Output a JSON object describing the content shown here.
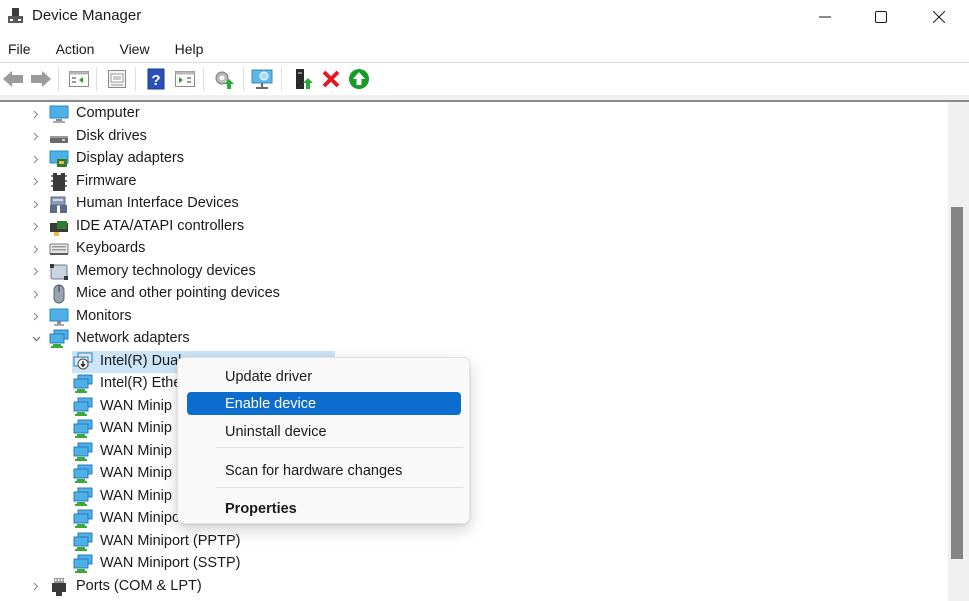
{
  "window": {
    "title": "Device Manager",
    "controls": [
      "minimize",
      "maximize",
      "close"
    ]
  },
  "menubar": {
    "items": [
      "File",
      "Action",
      "View",
      "Help"
    ]
  },
  "toolbar": {
    "buttons": [
      {
        "name": "back",
        "icon": "arrow-left-icon"
      },
      {
        "name": "forward",
        "icon": "arrow-right-icon"
      },
      {
        "name": "show-hide-console-tree",
        "icon": "console-tree-icon"
      },
      {
        "name": "properties",
        "icon": "properties-sheet-icon"
      },
      {
        "name": "help",
        "icon": "help-icon",
        "glyph": "?"
      },
      {
        "name": "show-hide-action-pane",
        "icon": "action-pane-icon"
      },
      {
        "name": "update-driver",
        "icon": "update-driver-icon"
      },
      {
        "name": "scan-hardware",
        "icon": "scan-monitor-icon"
      },
      {
        "name": "enable-legacy",
        "icon": "add-legacy-hardware-icon"
      },
      {
        "name": "uninstall-device",
        "icon": "red-x-icon"
      },
      {
        "name": "enable-device",
        "icon": "green-up-arrow-icon"
      }
    ]
  },
  "tree": {
    "items": [
      {
        "label": "Computer",
        "icon": "computer-icon",
        "expanded": false,
        "level": 1
      },
      {
        "label": "Disk drives",
        "icon": "disk-drive-icon",
        "expanded": false,
        "level": 1
      },
      {
        "label": "Display adapters",
        "icon": "display-adapter-icon",
        "expanded": false,
        "level": 1
      },
      {
        "label": "Firmware",
        "icon": "firmware-chip-icon",
        "expanded": false,
        "level": 1
      },
      {
        "label": "Human Interface Devices",
        "icon": "hid-icon",
        "expanded": false,
        "level": 1
      },
      {
        "label": "IDE ATA/ATAPI controllers",
        "icon": "ide-controller-icon",
        "expanded": false,
        "level": 1
      },
      {
        "label": "Keyboards",
        "icon": "keyboard-icon",
        "expanded": false,
        "level": 1
      },
      {
        "label": "Memory technology devices",
        "icon": "memory-device-icon",
        "expanded": false,
        "level": 1
      },
      {
        "label": "Mice and other pointing devices",
        "icon": "mouse-icon",
        "expanded": false,
        "level": 1
      },
      {
        "label": "Monitors",
        "icon": "monitor-icon",
        "expanded": false,
        "level": 1
      },
      {
        "label": "Network adapters",
        "icon": "network-adapter-icon",
        "expanded": true,
        "level": 1
      },
      {
        "label": "Intel(R) Dual",
        "icon": "network-adapter-disabled-icon",
        "level": 2,
        "selected": true
      },
      {
        "label": "Intel(R) Ethe",
        "icon": "network-adapter-icon",
        "level": 2
      },
      {
        "label": "WAN Minip",
        "icon": "network-adapter-icon",
        "level": 2
      },
      {
        "label": "WAN Minip",
        "icon": "network-adapter-icon",
        "level": 2
      },
      {
        "label": "WAN Minip",
        "icon": "network-adapter-icon",
        "level": 2
      },
      {
        "label": "WAN Minip",
        "icon": "network-adapter-icon",
        "level": 2
      },
      {
        "label": "WAN Minip",
        "icon": "network-adapter-icon",
        "level": 2
      },
      {
        "label": "WAN Minipo",
        "icon": "network-adapter-icon",
        "level": 2
      },
      {
        "label": "WAN Miniport (PPTP)",
        "icon": "network-adapter-icon",
        "level": 2
      },
      {
        "label": "WAN Miniport (SSTP)",
        "icon": "network-adapter-icon",
        "level": 2
      },
      {
        "label": "Ports (COM & LPT)",
        "icon": "port-icon",
        "expanded": false,
        "level": 1
      }
    ]
  },
  "context_menu": {
    "items": [
      {
        "label": "Update driver"
      },
      {
        "label": "Enable device",
        "highlighted": true
      },
      {
        "label": "Uninstall device"
      },
      {
        "label": "Scan for hardware changes"
      },
      {
        "label": "Properties",
        "bold": true
      }
    ]
  },
  "scrollbar": {
    "position_fraction": 0.25,
    "visible_fraction": 0.72
  },
  "colors": {
    "selection": "#cce4f7",
    "menu_highlight": "#0c6dcf",
    "uninstall_red": "#e01b24",
    "enable_green": "#1a9a2a"
  }
}
